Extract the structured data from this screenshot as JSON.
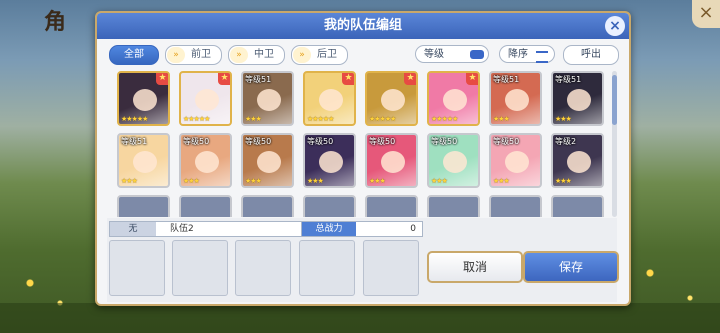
{
  "header": {
    "title": "我的队伍编组",
    "close": "×"
  },
  "background": {
    "logo": "角"
  },
  "filters": {
    "tabs": [
      "全部",
      "前卫",
      "中卫",
      "后卫"
    ],
    "chevron": "»"
  },
  "controls": {
    "level": "等级",
    "sort": "降序",
    "summon": "呼出"
  },
  "roster": {
    "row1": [
      {
        "level": "",
        "stars": "★★★★★",
        "badge": "★",
        "color": "#3a2c3e",
        "gold": true
      },
      {
        "level": "",
        "stars": "★★★★★",
        "badge": "★",
        "color": "#efe6ec",
        "gold": true
      },
      {
        "level": "等级51",
        "stars": "★★★",
        "badge": "",
        "color": "#8a6a4e",
        "gold": false
      },
      {
        "level": "",
        "stars": "★★★★★",
        "badge": "★",
        "color": "#f2d17a",
        "gold": true
      },
      {
        "level": "",
        "stars": "★★★★★",
        "badge": "★",
        "color": "#c89a3c",
        "gold": true
      },
      {
        "level": "",
        "stars": "★★★★★",
        "badge": "★",
        "color": "#f07aa6",
        "gold": true
      },
      {
        "level": "等级51",
        "stars": "★★★",
        "badge": "",
        "color": "#d46a52",
        "gold": false
      },
      {
        "level": "等级51",
        "stars": "★★★",
        "badge": "",
        "color": "#2e2a3c",
        "gold": false
      }
    ],
    "row2": [
      {
        "level": "等级51",
        "stars": "★★★",
        "badge": "",
        "color": "#f7d6a0",
        "gold": false
      },
      {
        "level": "等级50",
        "stars": "★★★",
        "badge": "",
        "color": "#e8a880",
        "gold": false
      },
      {
        "level": "等级50",
        "stars": "★★★",
        "badge": "",
        "color": "#b87a4c",
        "gold": false
      },
      {
        "level": "等级50",
        "stars": "★★★",
        "badge": "",
        "color": "#3c2e5a",
        "gold": false
      },
      {
        "level": "等级50",
        "stars": "★★★",
        "badge": "",
        "color": "#e6587a",
        "gold": false
      },
      {
        "level": "等级50",
        "stars": "★★★",
        "badge": "",
        "color": "#9fe0c0",
        "gold": false
      },
      {
        "level": "等级50",
        "stars": "★★★",
        "badge": "",
        "color": "#f4a6b4",
        "gold": false
      },
      {
        "level": "等级2",
        "stars": "★★★",
        "badge": "",
        "color": "#3e3650",
        "gold": false
      }
    ]
  },
  "party": {
    "label": "无",
    "name": "队伍2",
    "power_label": "总战力",
    "power_value": "0"
  },
  "buttons": {
    "cancel": "取消",
    "save": "保存"
  }
}
